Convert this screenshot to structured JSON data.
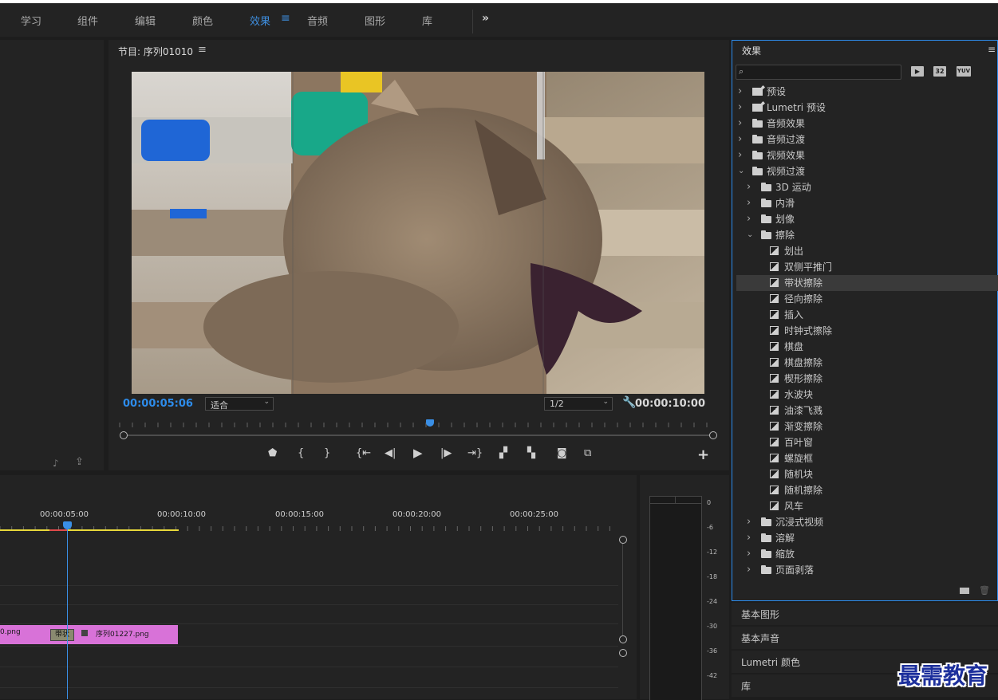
{
  "workspaces": {
    "items": [
      {
        "label": "学习"
      },
      {
        "label": "组件"
      },
      {
        "label": "编辑"
      },
      {
        "label": "颜色"
      },
      {
        "label": "效果",
        "active": true
      },
      {
        "label": "音频"
      },
      {
        "label": "图形"
      },
      {
        "label": "库"
      }
    ],
    "menu_glyph": "≡",
    "more_glyph": "»"
  },
  "program_monitor": {
    "title": "节目: 序列01010",
    "menu_glyph": "≡",
    "timecode_current": "00:00:05:06",
    "zoom_select": "适合",
    "resolution_select": "1/2",
    "timecode_duration": "00:00:10:00",
    "add_glyph": "+",
    "playhead_fraction": 0.52
  },
  "timeline": {
    "ruler_labels": [
      "00:00:05:00",
      "00:00:10:00",
      "00:00:15:00",
      "00:00:20:00",
      "00:00:25:00"
    ],
    "clip_left_name": "0.png",
    "transition_label": "带状",
    "clip_right_name": "序列01227.png"
  },
  "audio_meter": {
    "labels": [
      "0",
      "-6",
      "-12",
      "-18",
      "-24",
      "-30",
      "-36",
      "-42"
    ]
  },
  "effects_panel": {
    "title": "效果",
    "menu_glyph": "≡",
    "search_placeholder": "",
    "badges": [
      "32",
      "YUV"
    ],
    "tree": [
      {
        "label": "预设",
        "kind": "preset",
        "level": 0,
        "expanded": false
      },
      {
        "label": "Lumetri 预设",
        "kind": "preset",
        "level": 0,
        "expanded": false
      },
      {
        "label": "音频效果",
        "kind": "folder",
        "level": 0,
        "expanded": false
      },
      {
        "label": "音频过渡",
        "kind": "folder",
        "level": 0,
        "expanded": false
      },
      {
        "label": "视频效果",
        "kind": "folder",
        "level": 0,
        "expanded": false
      },
      {
        "label": "视频过渡",
        "kind": "folder",
        "level": 0,
        "expanded": true
      },
      {
        "label": "3D 运动",
        "kind": "folder",
        "level": 1,
        "expanded": false
      },
      {
        "label": "内滑",
        "kind": "folder",
        "level": 1,
        "expanded": false
      },
      {
        "label": "划像",
        "kind": "folder",
        "level": 1,
        "expanded": false
      },
      {
        "label": "擦除",
        "kind": "folder",
        "level": 1,
        "expanded": true
      },
      {
        "label": "划出",
        "kind": "effect",
        "level": 2
      },
      {
        "label": "双侧平推门",
        "kind": "effect",
        "level": 2
      },
      {
        "label": "带状擦除",
        "kind": "effect",
        "level": 2,
        "selected": true
      },
      {
        "label": "径向擦除",
        "kind": "effect",
        "level": 2
      },
      {
        "label": "插入",
        "kind": "effect",
        "level": 2
      },
      {
        "label": "时钟式擦除",
        "kind": "effect",
        "level": 2
      },
      {
        "label": "棋盘",
        "kind": "effect",
        "level": 2
      },
      {
        "label": "棋盘擦除",
        "kind": "effect",
        "level": 2
      },
      {
        "label": "楔形擦除",
        "kind": "effect",
        "level": 2
      },
      {
        "label": "水波块",
        "kind": "effect",
        "level": 2
      },
      {
        "label": "油漆飞溅",
        "kind": "effect",
        "level": 2
      },
      {
        "label": "渐变擦除",
        "kind": "effect",
        "level": 2
      },
      {
        "label": "百叶窗",
        "kind": "effect",
        "level": 2
      },
      {
        "label": "螺旋框",
        "kind": "effect",
        "level": 2
      },
      {
        "label": "随机块",
        "kind": "effect",
        "level": 2
      },
      {
        "label": "随机擦除",
        "kind": "effect",
        "level": 2
      },
      {
        "label": "风车",
        "kind": "effect",
        "level": 2
      },
      {
        "label": "沉浸式视频",
        "kind": "folder",
        "level": 1,
        "expanded": false
      },
      {
        "label": "溶解",
        "kind": "folder",
        "level": 1,
        "expanded": false
      },
      {
        "label": "缩放",
        "kind": "folder",
        "level": 1,
        "expanded": false
      },
      {
        "label": "页面剥落",
        "kind": "folder",
        "level": 1,
        "expanded": false
      }
    ]
  },
  "collapsed_panels": [
    "基本图形",
    "基本声音",
    "Lumetri 颜色",
    "库"
  ],
  "watermark": "最需教育",
  "colors": {
    "accent": "#2d8ceb",
    "clip": "#d872d8",
    "inout": "#e8d83a"
  }
}
